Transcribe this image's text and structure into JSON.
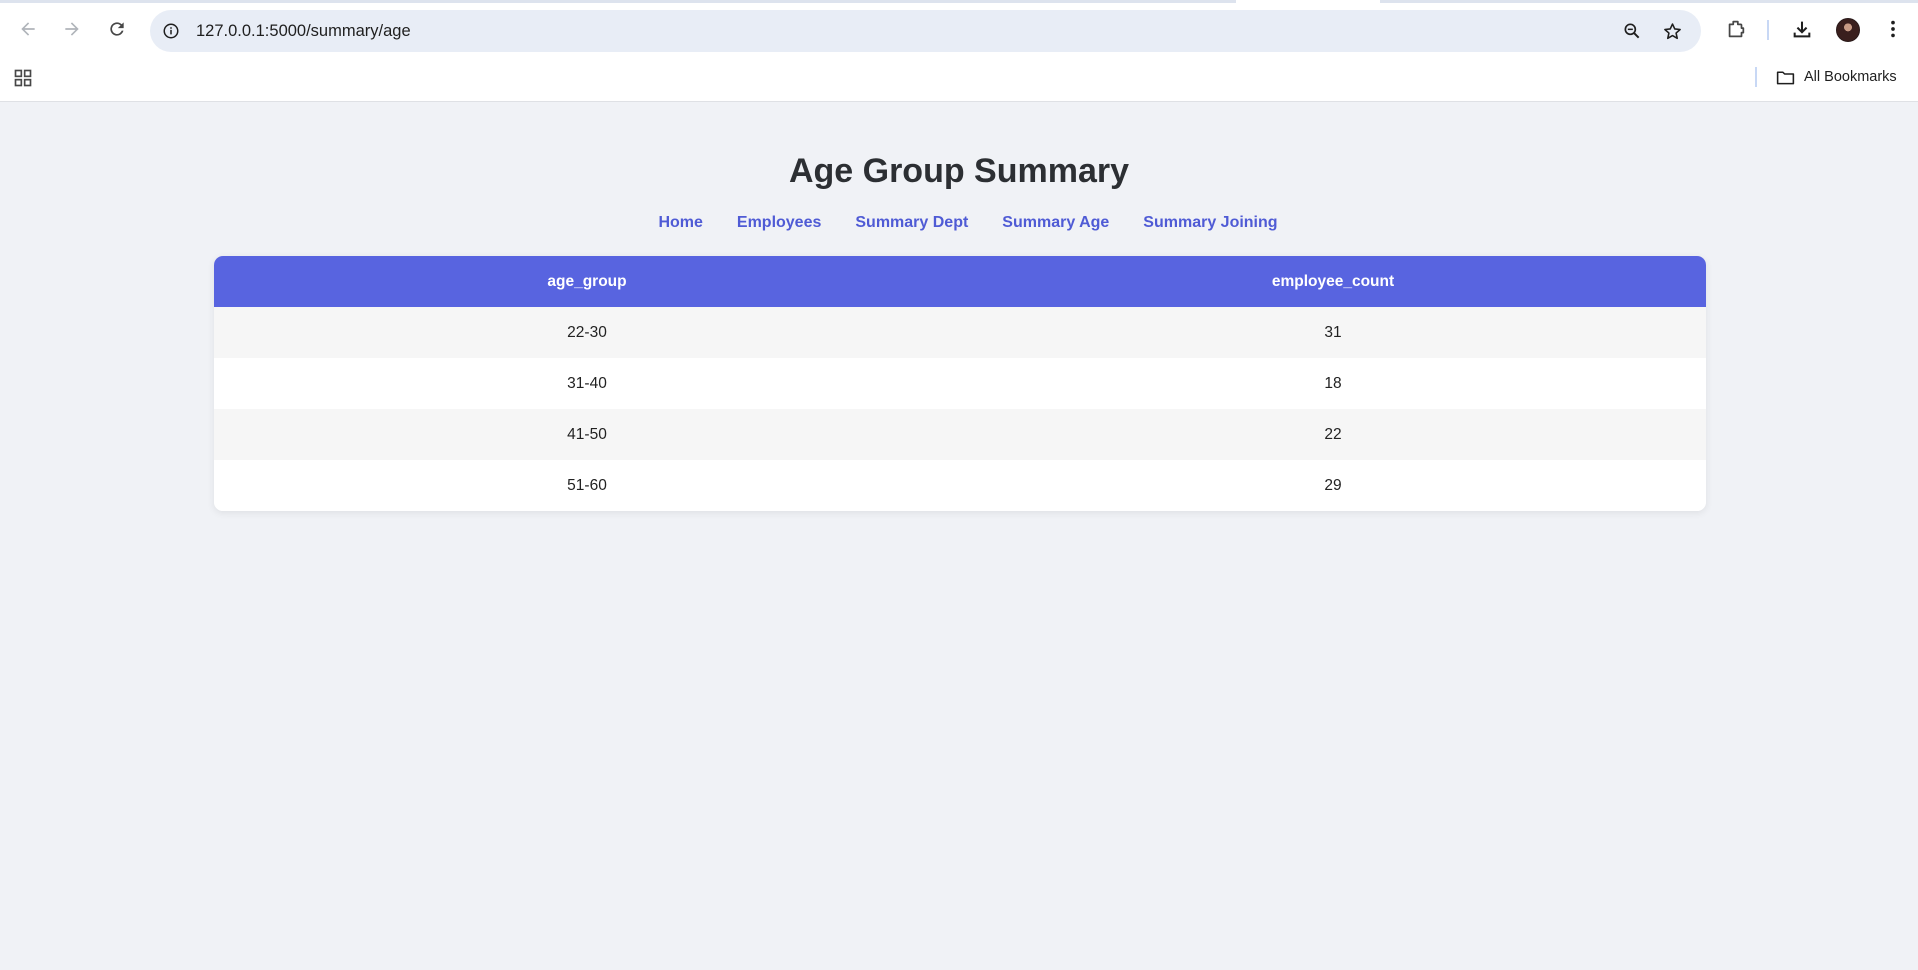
{
  "browser": {
    "url": "127.0.0.1:5000/summary/age",
    "bookmarks_label": "All Bookmarks"
  },
  "page": {
    "title": "Age Group Summary",
    "nav": [
      {
        "label": "Home"
      },
      {
        "label": "Employees"
      },
      {
        "label": "Summary Dept"
      },
      {
        "label": "Summary Age"
      },
      {
        "label": "Summary Joining"
      }
    ]
  },
  "table": {
    "headers": [
      "age_group",
      "employee_count"
    ],
    "rows": [
      [
        "22-30",
        "31"
      ],
      [
        "31-40",
        "18"
      ],
      [
        "41-50",
        "22"
      ],
      [
        "51-60",
        "29"
      ]
    ]
  },
  "colors": {
    "header_bg": "#5864e0",
    "nav_link": "#4f5bd5",
    "page_bg": "#f0f2f6"
  },
  "icons": [
    "back-arrow-icon",
    "forward-arrow-icon",
    "reload-icon",
    "site-info-icon",
    "zoom-icon",
    "bookmark-star-icon",
    "extensions-icon",
    "download-icon",
    "avatar",
    "menu-dots-icon",
    "apps-grid-icon",
    "folder-icon"
  ]
}
